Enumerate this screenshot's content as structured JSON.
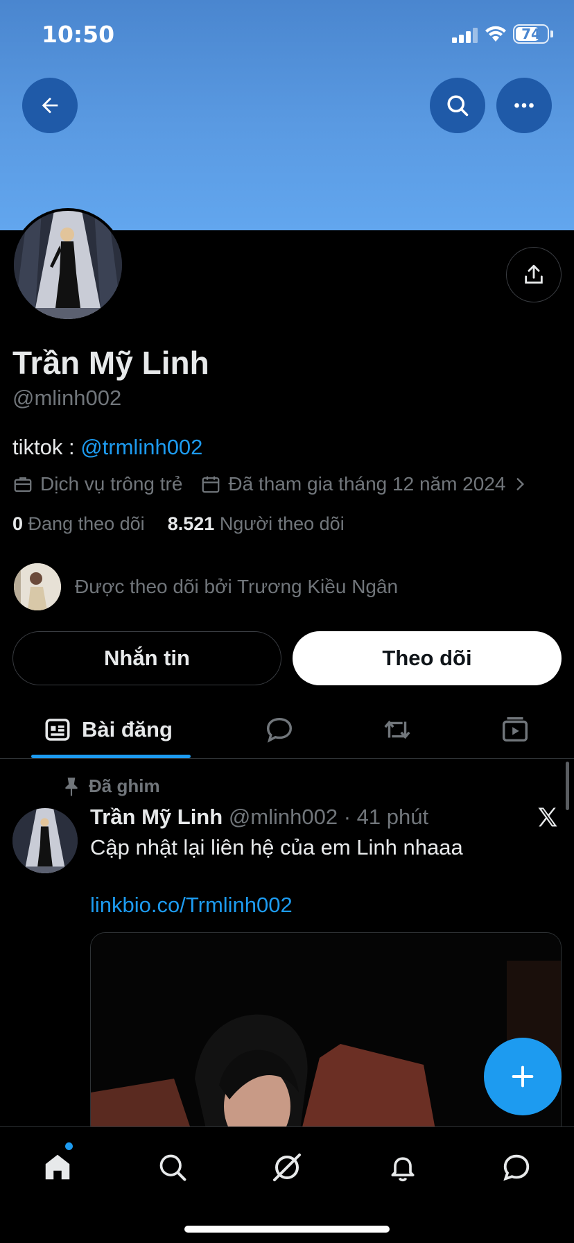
{
  "status_bar": {
    "time": "10:50",
    "battery": "74",
    "battery_level": 0.74,
    "signal_icon": "cellular-signal-icon",
    "wifi_icon": "wifi-icon"
  },
  "header": {
    "back_icon": "arrow-left-icon",
    "search_icon": "search-icon",
    "more_icon": "ellipsis-icon",
    "banner_color": "#5a9ae2"
  },
  "profile": {
    "name": "Trần Mỹ Linh",
    "handle": "@mlinh002",
    "bio_prefix": "tiktok : ",
    "bio_link": "@trmlinh002",
    "category": "Dịch vụ trông trẻ",
    "joined": "Đã tham gia tháng 12 năm 2024",
    "following_count": "0",
    "following_label": "Đang theo dõi",
    "followers_count": "8.521",
    "followers_label": "Người theo dõi",
    "followed_by": "Được theo dõi bởi Trương Kiều Ngân",
    "share_icon": "share-icon"
  },
  "actions": {
    "message_label": "Nhắn tin",
    "follow_label": "Theo dõi"
  },
  "tabs": [
    {
      "label": "Bài đăng",
      "icon": "posts-icon",
      "active": true
    },
    {
      "label": "",
      "icon": "replies-icon"
    },
    {
      "label": "",
      "icon": "repost-icon"
    },
    {
      "label": "",
      "icon": "media-icon"
    }
  ],
  "post": {
    "pinned_label": "Đã ghim",
    "author": "Trần Mỹ Linh",
    "handle_time": "@mlinh002 · 41 phút",
    "text": "Cập nhật lại liên hệ của em Linh nhaaa",
    "link": "linkbio.co/Trmlinh002"
  },
  "colors": {
    "accent": "#1d9bf0",
    "background": "#000000",
    "muted": "#71767b"
  },
  "bottom_nav": [
    {
      "icon": "home-icon",
      "active": true
    },
    {
      "icon": "search-icon"
    },
    {
      "icon": "grok-icon"
    },
    {
      "icon": "bell-icon"
    },
    {
      "icon": "messages-icon"
    }
  ]
}
